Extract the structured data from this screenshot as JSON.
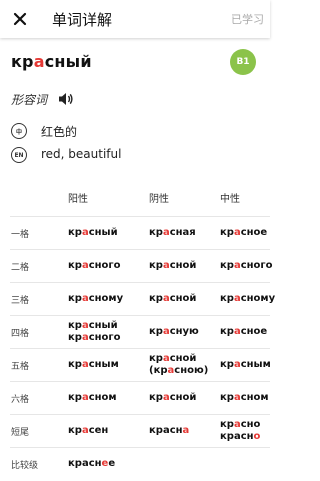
{
  "header": {
    "title": "单词详解",
    "learned_label": "已学习"
  },
  "word": {
    "pre": "кр",
    "stress": "а",
    "post": "сный",
    "level": "B1"
  },
  "part_of_speech": "形容词",
  "meanings": [
    {
      "badge": "中",
      "text": "红色的"
    },
    {
      "badge": "EN",
      "text": "red, beautiful"
    }
  ],
  "table": {
    "columns": [
      "阳性",
      "阴性",
      "中性"
    ],
    "rows": [
      {
        "label": "一格",
        "cells": [
          {
            "lines": [
              [
                "кр",
                "а",
                "сный"
              ]
            ]
          },
          {
            "lines": [
              [
                "кр",
                "а",
                "сная"
              ]
            ]
          },
          {
            "lines": [
              [
                "кр",
                "а",
                "сное"
              ]
            ]
          }
        ]
      },
      {
        "label": "二格",
        "cells": [
          {
            "lines": [
              [
                "кр",
                "а",
                "сного"
              ]
            ]
          },
          {
            "lines": [
              [
                "кр",
                "а",
                "сной"
              ]
            ]
          },
          {
            "lines": [
              [
                "кр",
                "а",
                "сного"
              ]
            ]
          }
        ]
      },
      {
        "label": "三格",
        "cells": [
          {
            "lines": [
              [
                "кр",
                "а",
                "сному"
              ]
            ]
          },
          {
            "lines": [
              [
                "кр",
                "а",
                "сной"
              ]
            ]
          },
          {
            "lines": [
              [
                "кр",
                "а",
                "сному"
              ]
            ]
          }
        ]
      },
      {
        "label": "四格",
        "cells": [
          {
            "lines": [
              [
                "кр",
                "а",
                "сный"
              ],
              [
                "кр",
                "а",
                "сного"
              ]
            ]
          },
          {
            "lines": [
              [
                "кр",
                "а",
                "сную"
              ]
            ]
          },
          {
            "lines": [
              [
                "кр",
                "а",
                "сное"
              ]
            ]
          }
        ]
      },
      {
        "label": "五格",
        "cells": [
          {
            "lines": [
              [
                "кр",
                "а",
                "сным"
              ]
            ]
          },
          {
            "lines": [
              [
                "кр",
                "а",
                "сной"
              ],
              [
                "(кр",
                "а",
                "сною)"
              ]
            ]
          },
          {
            "lines": [
              [
                "кр",
                "а",
                "сным"
              ]
            ]
          }
        ]
      },
      {
        "label": "六格",
        "cells": [
          {
            "lines": [
              [
                "кр",
                "а",
                "сном"
              ]
            ]
          },
          {
            "lines": [
              [
                "кр",
                "а",
                "сной"
              ]
            ]
          },
          {
            "lines": [
              [
                "кр",
                "а",
                "сном"
              ]
            ]
          }
        ]
      },
      {
        "label": "短尾",
        "cells": [
          {
            "lines": [
              [
                "кр",
                "а",
                "сен"
              ]
            ]
          },
          {
            "lines": [
              [
                "красн",
                "а",
                ""
              ]
            ]
          },
          {
            "lines": [
              [
                "кр",
                "а",
                "сно"
              ],
              [
                "красн",
                "о",
                ""
              ]
            ]
          }
        ]
      },
      {
        "label": "比较级",
        "cells": [
          {
            "lines": [
              [
                "красн",
                "е",
                "е"
              ]
            ]
          },
          {
            "lines": []
          },
          {
            "lines": []
          }
        ]
      }
    ]
  }
}
